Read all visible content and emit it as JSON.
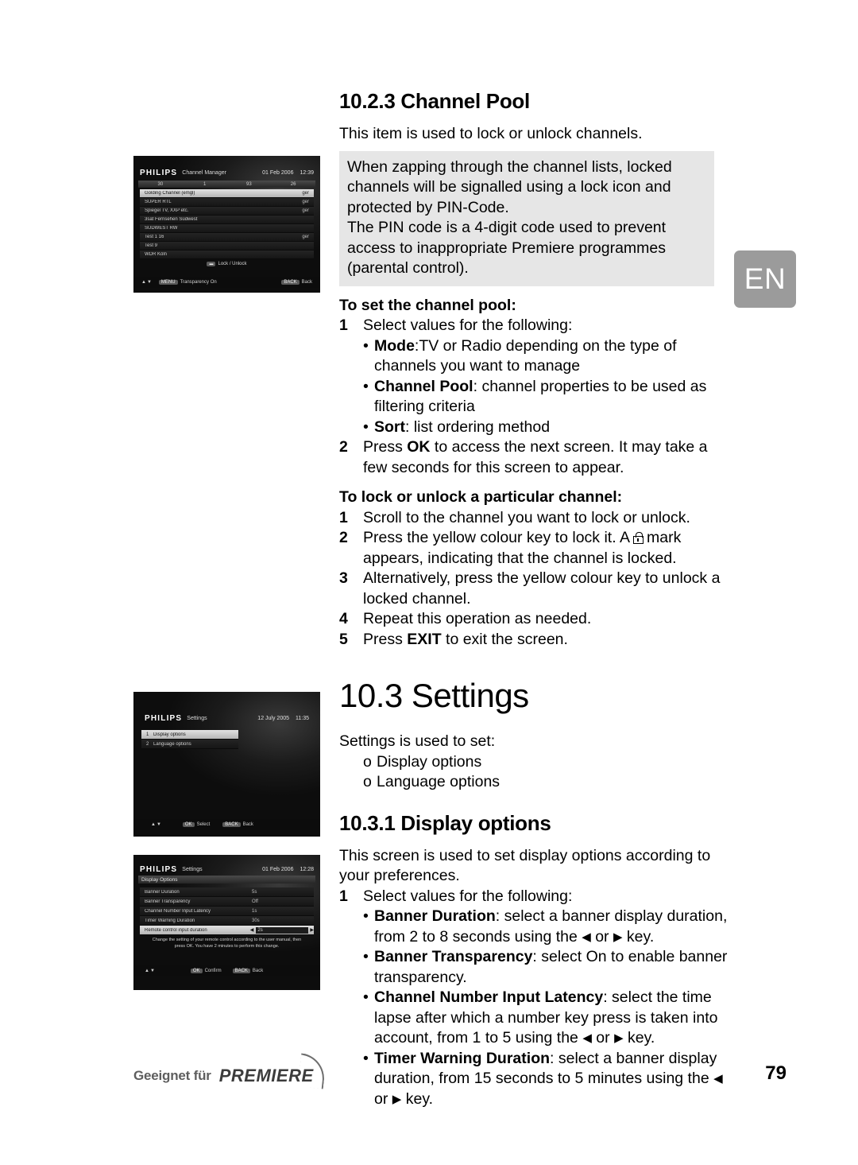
{
  "page": {
    "number": "79",
    "language_tab": "EN",
    "footer_brand_prefix": "Geeignet für",
    "footer_brand": "PREMIERE"
  },
  "section_channel_pool": {
    "heading": "10.2.3 Channel Pool",
    "intro": "This item is used to lock or unlock channels.",
    "callout": [
      "When zapping through the channel lists, locked channels will be signalled using a lock icon and protected by PIN-Code.",
      "The PIN code is a 4-digit code used to prevent access to inappropriate Premiere programmes (parental control)."
    ],
    "set_pool": {
      "subhead": "To set the channel pool:",
      "step1_num": "1",
      "step1_text": "Select values for the following:",
      "bullets": [
        {
          "term": "Mode",
          "sep": ":",
          "rest": "TV or Radio depending on the type of channels you want to manage"
        },
        {
          "term": "Channel Pool",
          "sep": ": ",
          "rest": "channel properties to be used as filtering criteria"
        },
        {
          "term": "Sort",
          "sep": ": ",
          "rest": "list ordering method"
        }
      ],
      "step2_num": "2",
      "step2_pre": "Press ",
      "step2_bold": "OK",
      "step2_post": " to access the next screen. It may take a few seconds for this screen to appear."
    },
    "lock_unlock": {
      "subhead": "To lock or unlock a particular channel:",
      "steps": [
        {
          "num": "1",
          "text": "Scroll to the channel you want to lock or unlock."
        },
        {
          "num": "2",
          "text_before": "Press the yellow colour key to lock it. A",
          "text_after": "mark appears, indicating that the channel is locked."
        },
        {
          "num": "3",
          "text": "Alternatively, press the yellow colour key to unlock a locked channel."
        },
        {
          "num": "4",
          "text": "Repeat this operation as needed."
        },
        {
          "num": "5",
          "pre": "Press ",
          "bold": "EXIT",
          "post": " to exit the screen."
        }
      ]
    }
  },
  "section_settings": {
    "heading": "10.3 Settings",
    "intro": "Settings is used to set:",
    "options": [
      {
        "marker": "o",
        "label": "Display options"
      },
      {
        "marker": "o",
        "label": "Language options"
      }
    ]
  },
  "section_display_options": {
    "heading": "10.3.1 Display options",
    "intro": "This screen is used to set display options according to your preferences.",
    "step1_num": "1",
    "step1_text": "Select values for the following:",
    "bullets": [
      {
        "term": "Banner Duration",
        "sep": ": ",
        "rest_a": "select a banner display duration, from 2 to 8 seconds using the ",
        "arrow1": "◀",
        "mid": " or ",
        "arrow2": "▶",
        "rest_b": " key."
      },
      {
        "term": "Banner Transparency",
        "sep": ": ",
        "rest_a": "select On to enable banner transparency.",
        "arrow1": "",
        "mid": "",
        "arrow2": "",
        "rest_b": ""
      },
      {
        "term": "Channel Number Input Latency",
        "sep": ": ",
        "rest_a": "select the time lapse after which a number key press is taken into account, from 1 to 5 using the ",
        "arrow1": "◀",
        "mid": " or ",
        "arrow2": "▶",
        "rest_b": " key."
      },
      {
        "term": "Timer Warning Duration",
        "sep": ": ",
        "rest_a": "select a banner display duration, from 15 seconds to 5 minutes using the ",
        "arrow1": "◀",
        "mid": " or ",
        "arrow2": "▶",
        "rest_b": " key."
      }
    ]
  },
  "tv_channel_manager": {
    "brand": "PHILIPS",
    "title": "Channel Manager",
    "date": "01 Feb 2006",
    "time": "12:39",
    "columns": [
      "30",
      "1",
      "93",
      "26"
    ],
    "rows": [
      {
        "label": "Golding Channel (emgl)",
        "value": "ger",
        "selected": true
      },
      {
        "label": "SUPER RTL",
        "value": "ger",
        "selected": false
      },
      {
        "label": "Spiegel TV, XXP etc.",
        "value": "ger",
        "selected": false
      },
      {
        "label": "3sat Fernsehen Südwest",
        "value": "",
        "selected": false
      },
      {
        "label": "SÜDWEST RW",
        "value": "",
        "selected": false
      },
      {
        "label": "Test 1 16",
        "value": "ger",
        "selected": false
      },
      {
        "label": "Test 9",
        "value": "",
        "selected": false
      },
      {
        "label": "WDR Köln",
        "value": "",
        "selected": false
      }
    ],
    "key_hint": "Lock / Unlock",
    "foot_key": "MENU",
    "foot_label": "Transparency On",
    "back_key": "BACK",
    "back_label": "Back"
  },
  "tv_settings": {
    "brand": "PHILIPS",
    "title": "Settings",
    "date": "12 July 2005",
    "time": "11:35",
    "menu": [
      {
        "num": "1",
        "label": "Display options",
        "selected": true
      },
      {
        "num": "2",
        "label": "Language options",
        "selected": false
      }
    ],
    "select_key": "OK",
    "select_label": "Select",
    "back_key": "BACK",
    "back_label": "Back"
  },
  "tv_display_options": {
    "brand": "PHILIPS",
    "title": "Settings",
    "date": "01 Feb 2006",
    "time": "12:28",
    "subtitle": "Display Options",
    "rows": [
      {
        "label": "Banner Duration",
        "value": "5s",
        "selected": false
      },
      {
        "label": "Banner Transparency",
        "value": "Off",
        "selected": false
      },
      {
        "label": "Channel Number Input Latency",
        "value": "1s",
        "selected": false
      },
      {
        "label": "Timer Warning Duration",
        "value": "30s",
        "selected": false
      },
      {
        "label": "Remote control input duration",
        "value": "2s",
        "selected": true
      }
    ],
    "help_text": "Change the setting of your remote control according to the user manual, then press OK. You have 2 minutes to perform this change.",
    "confirm_key": "OK",
    "confirm_label": "Confirm",
    "back_key": "BACK",
    "back_label": "Back"
  }
}
